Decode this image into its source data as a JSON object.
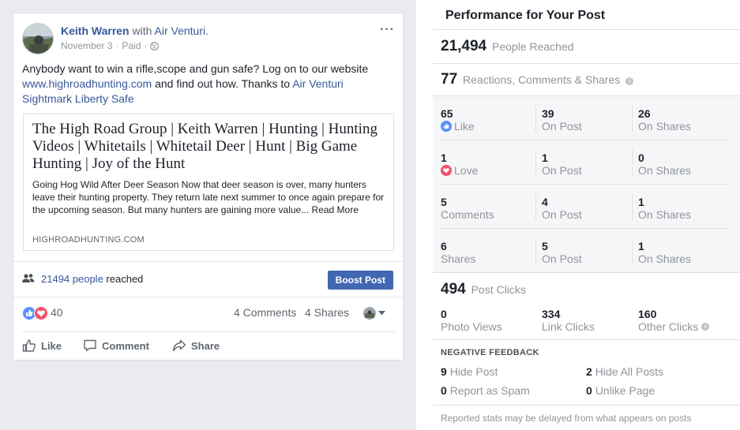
{
  "post": {
    "author": "Keith Warren",
    "with_text": "with",
    "tagged_page": "Air Venturi",
    "tagged_suffix": ".",
    "date": "November 3",
    "separator": "·",
    "paid": "Paid",
    "menu_label": "···",
    "text_part1": "Anybody want to win a rifle,scope and gun safe? Log on to our website ",
    "text_link": "www.highroadhunting.com",
    "text_part2": " and find out how. Thanks to ",
    "text_tag1": "Air Venturi",
    "text_tag2": "Sightmark",
    "text_tag3": "Liberty Safe",
    "link_preview": {
      "title": "The High Road Group | Keith Warren | Hunting | Hunting Videos | Whitetails | Whitetail Deer | Hunt | Big Game Hunting | Joy of the Hunt",
      "description": "Going Hog Wild After Deer Season Now that deer season is over, many hunters leave their hunting property. They return late next summer to once again prepare for the upcoming season. But many hunters are gaining more value... Read More",
      "domain": "HIGHROADHUNTING.COM"
    },
    "reach_count": "21494 people",
    "reach_suffix": " reached",
    "boost_label": "Boost Post",
    "reactions_count": "40",
    "comments_label": "4 Comments",
    "shares_label": "4 Shares",
    "actions": {
      "like": "Like",
      "comment": "Comment",
      "share": "Share"
    }
  },
  "insights": {
    "title": "Performance for Your Post",
    "people_reached_num": "21,494",
    "people_reached_label": "People Reached",
    "engagement_num": "77",
    "engagement_label": "Reactions, Comments & Shares",
    "breakdown": [
      {
        "total": "65",
        "label": "Like",
        "on_post": "39",
        "on_post_label": "On Post",
        "on_shares": "26",
        "on_shares_label": "On Shares"
      },
      {
        "total": "1",
        "label": "Love",
        "on_post": "1",
        "on_post_label": "On Post",
        "on_shares": "0",
        "on_shares_label": "On Shares"
      },
      {
        "total": "5",
        "label": "Comments",
        "on_post": "4",
        "on_post_label": "On Post",
        "on_shares": "1",
        "on_shares_label": "On Shares"
      },
      {
        "total": "6",
        "label": "Shares",
        "on_post": "5",
        "on_post_label": "On Post",
        "on_shares": "1",
        "on_shares_label": "On Shares"
      }
    ],
    "post_clicks_num": "494",
    "post_clicks_label": "Post Clicks",
    "photo_views_num": "0",
    "photo_views_label": "Photo Views",
    "link_clicks_num": "334",
    "link_clicks_label": "Link Clicks",
    "other_clicks_num": "160",
    "other_clicks_label": "Other Clicks",
    "negative_title": "NEGATIVE FEEDBACK",
    "hide_post_num": "9",
    "hide_post_label": "Hide Post",
    "hide_all_num": "2",
    "hide_all_label": "Hide All Posts",
    "spam_num": "0",
    "spam_label": "Report as Spam",
    "unlike_num": "0",
    "unlike_label": "Unlike Page",
    "footnote": "Reported stats may be delayed from what appears on posts"
  },
  "colors": {
    "link": "#365899",
    "like_blue": "#5890ff",
    "love_red": "#f25268",
    "boost_blue": "#4267b2",
    "muted": "#90949c"
  },
  "icons": [
    "globe-icon",
    "people-icon",
    "like-reaction-icon",
    "love-reaction-icon",
    "thumbs-up-icon",
    "comment-icon",
    "share-icon",
    "info-icon",
    "chevron-down-icon"
  ]
}
